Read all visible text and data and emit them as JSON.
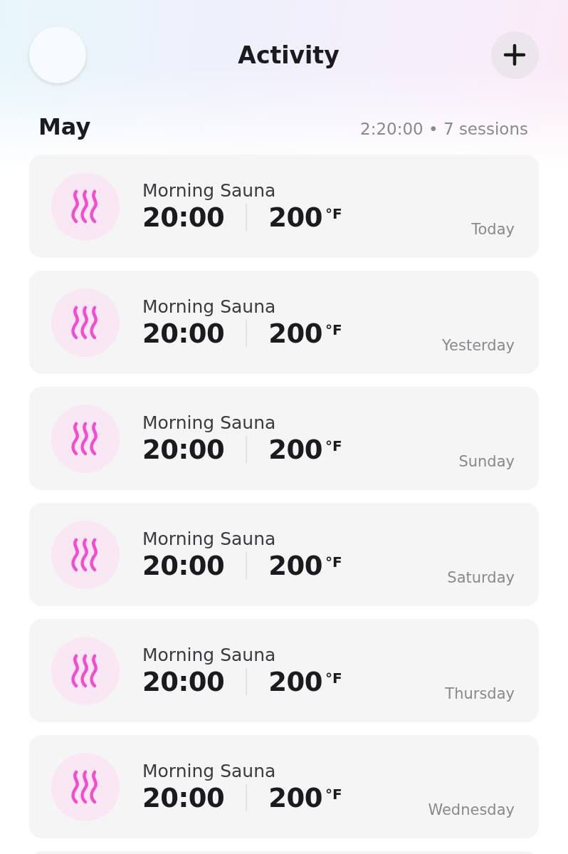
{
  "header": {
    "title": "Activity"
  },
  "month": {
    "label": "May",
    "summary": "2:20:00 • 7 sessions"
  },
  "sessions": [
    {
      "name": "Morning Sauna",
      "duration": "20:00",
      "temperature": "200",
      "unit": "°F",
      "day": "Today"
    },
    {
      "name": "Morning Sauna",
      "duration": "20:00",
      "temperature": "200",
      "unit": "°F",
      "day": "Yesterday"
    },
    {
      "name": "Morning Sauna",
      "duration": "20:00",
      "temperature": "200",
      "unit": "°F",
      "day": "Sunday"
    },
    {
      "name": "Morning Sauna",
      "duration": "20:00",
      "temperature": "200",
      "unit": "°F",
      "day": "Saturday"
    },
    {
      "name": "Morning Sauna",
      "duration": "20:00",
      "temperature": "200",
      "unit": "°F",
      "day": "Thursday"
    },
    {
      "name": "Morning Sauna",
      "duration": "20:00",
      "temperature": "200",
      "unit": "°F",
      "day": "Wednesday"
    }
  ]
}
